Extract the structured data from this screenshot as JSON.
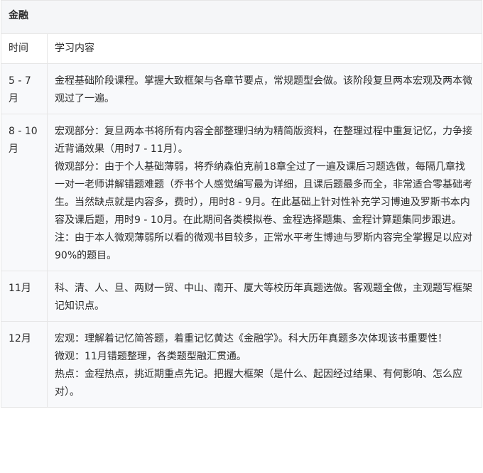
{
  "section_title": "金融",
  "columns": {
    "time": "时间",
    "content": "学习内容"
  },
  "rows": [
    {
      "time": "5 - 7月",
      "paragraphs": [
        "金程基础阶段课程。掌握大致框架与各章节要点，常规题型会做。该阶段复旦两本宏观及两本微观过了一遍。"
      ]
    },
    {
      "time": "8 - 10月",
      "paragraphs": [
        "宏观部分：复旦两本书将所有内容全部整理归纳为精简版资料，在整理过程中重复记忆，力争接近背诵效果（用时7 - 11月）。",
        "微观部分：由于个人基础薄弱，将乔纳森伯克前18章全过了一遍及课后习题选做，每隔几章找一对一老师讲解错题难题（乔书个人感觉编写最为详细，且课后题最多而全，非常适合零基础考生。当然缺点就是内容多，费时），用时8 - 9月。在此基础上针对性补充学习博迪及罗斯书本内容及课后题，用时9 - 10月。在此期间各类模拟卷、金程选择题集、金程计算题集同步跟进。",
        "注：由于本人微观薄弱所以看的微观书目较多，正常水平考生博迪与罗斯内容完全掌握足以应对90%的题目。"
      ]
    },
    {
      "time": "11月",
      "paragraphs": [
        "科、清、人、旦、两财一贸、中山、南开、厦大等校历年真题选做。客观题全做，主观题写框架记知识点。"
      ]
    },
    {
      "time": "12月",
      "paragraphs": [
        "宏观：理解着记忆简答题，着重记忆黄达《金融学》。科大历年真题多次体现该书重要性！",
        "微观：11月错题整理，各类题型融汇贯通。",
        "热点：金程热点，挑近期重点先记。把握大框架（是什么、起因经过结果、有何影响、怎么应对）。"
      ]
    }
  ]
}
